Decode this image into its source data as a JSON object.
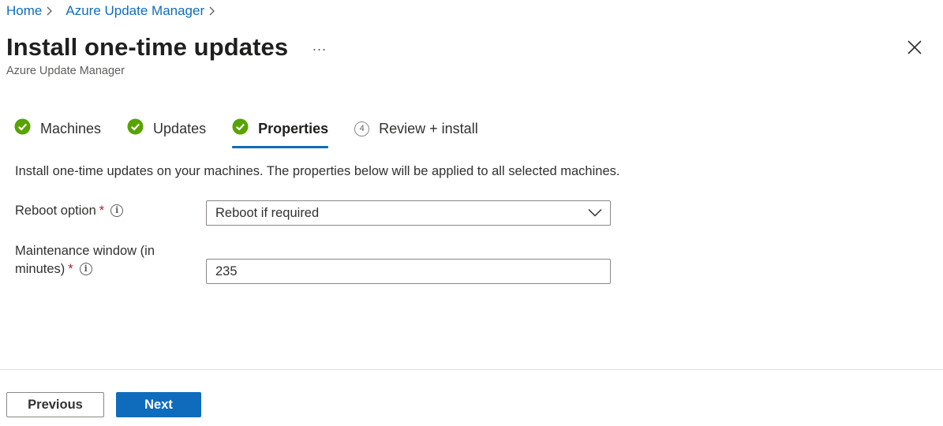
{
  "breadcrumb": {
    "items": [
      "Home",
      "Azure Update Manager"
    ]
  },
  "header": {
    "title": "Install one-time updates",
    "more": "...",
    "subtitle": "Azure Update Manager"
  },
  "steps": [
    {
      "label": "Machines",
      "status": "complete"
    },
    {
      "label": "Updates",
      "status": "complete"
    },
    {
      "label": "Properties",
      "status": "active"
    },
    {
      "label": "Review + install",
      "status": "pending",
      "number": "4"
    }
  ],
  "description": "Install one-time updates on your machines. The properties below will be applied to all selected machines.",
  "form": {
    "reboot_label": "Reboot option",
    "reboot_value": "Reboot if required",
    "maintenance_label_line1": "Maintenance window (in",
    "maintenance_label_line2": "minutes)",
    "maintenance_value": "235",
    "required_mark": "*",
    "info_glyph": "i"
  },
  "footer": {
    "previous_label": "Previous",
    "next_label": "Next"
  },
  "colors": {
    "accent": "#0f6cbd",
    "success": "#57a300",
    "required": "#a4262c"
  }
}
